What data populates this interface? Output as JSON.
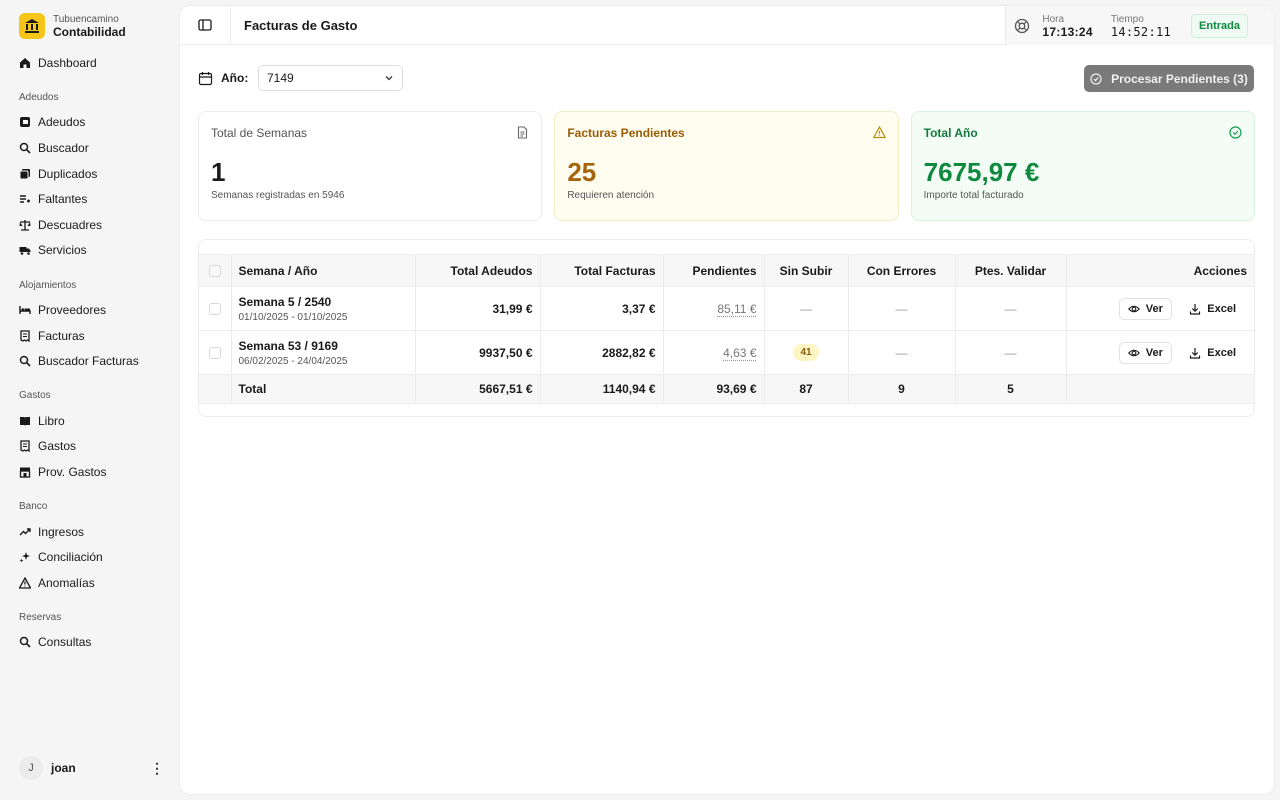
{
  "brand": {
    "sub": "Tubuencamino",
    "title": "Contabilidad"
  },
  "nav": {
    "dashboard": "Dashboard",
    "groups": [
      {
        "title": "Adeudos",
        "items": [
          {
            "label": "Adeudos",
            "icon": "adeudos-icon"
          },
          {
            "label": "Buscador",
            "icon": "search-icon"
          },
          {
            "label": "Duplicados",
            "icon": "copy-icon"
          },
          {
            "label": "Faltantes",
            "icon": "list-missing-icon"
          },
          {
            "label": "Descuadres",
            "icon": "scale-icon"
          },
          {
            "label": "Servicios",
            "icon": "truck-icon"
          }
        ]
      },
      {
        "title": "Alojamientos",
        "items": [
          {
            "label": "Proveedores",
            "icon": "bed-icon"
          },
          {
            "label": "Facturas",
            "icon": "receipt-icon"
          },
          {
            "label": "Buscador Facturas",
            "icon": "search-icon"
          }
        ]
      },
      {
        "title": "Gastos",
        "items": [
          {
            "label": "Libro",
            "icon": "book-icon"
          },
          {
            "label": "Gastos",
            "icon": "receipt-icon"
          },
          {
            "label": "Prov. Gastos",
            "icon": "store-icon"
          }
        ]
      },
      {
        "title": "Banco",
        "items": [
          {
            "label": "Ingresos",
            "icon": "trend-up-icon"
          },
          {
            "label": "Conciliación",
            "icon": "sparkle-icon"
          },
          {
            "label": "Anomalías",
            "icon": "warning-icon"
          }
        ]
      },
      {
        "title": "Reservas",
        "items": [
          {
            "label": "Consultas",
            "icon": "search-icon"
          }
        ]
      }
    ]
  },
  "user": {
    "initial": "J",
    "name": "joan",
    "menu": "⋮"
  },
  "header": {
    "title": "Facturas de Gasto",
    "hora_label": "Hora",
    "hora_value": "17:13:24",
    "tiempo_label": "Tiempo",
    "tiempo_value": "14:52:11",
    "status": "Entrada"
  },
  "toolbar": {
    "year_label": "Año:",
    "year_value": "7149",
    "process_label": "Procesar Pendientes (3)"
  },
  "cards": [
    {
      "title": "Total de Semanas",
      "value": "1",
      "desc": "Semanas registradas en 5946",
      "icon": "document-icon"
    },
    {
      "title": "Facturas Pendientes",
      "value": "25",
      "desc": "Requieren atención",
      "icon": "warning-icon"
    },
    {
      "title": "Total Año",
      "value": "7675,97 €",
      "desc": "Importe total facturado",
      "icon": "check-circle-icon"
    }
  ],
  "table": {
    "headers": [
      "Semana / Año",
      "Total Adeudos",
      "Total Facturas",
      "Pendientes",
      "Sin Subir",
      "Con Errores",
      "Ptes. Validar",
      "Acciones"
    ],
    "rows": [
      {
        "semana": "Semana 5 / 2540",
        "fechas": "01/10/2025 - 01/10/2025",
        "adeudos": "31,99 €",
        "facturas": "3,37 €",
        "pendientes": "85,11 €",
        "sin_subir": "—",
        "errores": "—",
        "validar": "—"
      },
      {
        "semana": "Semana 53 / 9169",
        "fechas": "06/02/2025 - 24/04/2025",
        "adeudos": "9937,50 €",
        "facturas": "2882,82 €",
        "pendientes": "4,63 €",
        "sin_subir": "41",
        "errores": "—",
        "validar": "—"
      }
    ],
    "ver_label": "Ver",
    "excel_label": "Excel",
    "total": {
      "label": "Total",
      "adeudos": "5667,51 €",
      "facturas": "1140,94 €",
      "pendientes": "93,69 €",
      "sin_subir": "87",
      "errores": "9",
      "validar": "5"
    }
  },
  "colors": {
    "brand": "#f5c518",
    "warn": "#a6630c",
    "success": "#0d8a3e",
    "process_button": "#7a7a7a"
  }
}
